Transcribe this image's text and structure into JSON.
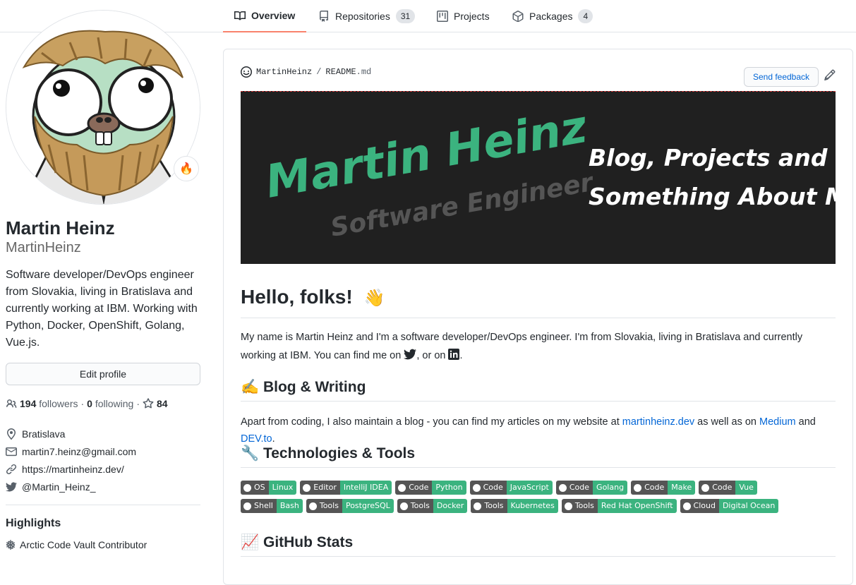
{
  "tabs": [
    {
      "label": "Overview",
      "icon": "book-icon"
    },
    {
      "label": "Repositories",
      "icon": "repo-icon",
      "count": "31"
    },
    {
      "label": "Projects",
      "icon": "project-icon"
    },
    {
      "label": "Packages",
      "icon": "package-icon",
      "count": "4"
    }
  ],
  "profile": {
    "status_emoji": "🔥",
    "fullname": "Martin Heinz",
    "username": "MartinHeinz",
    "bio": "Software developer/DevOps engineer from Slovakia, living in Bratislava and currently working at IBM. Working with Python, Docker, OpenShift, Golang, Vue.js.",
    "edit_label": "Edit profile",
    "followers_count": "194",
    "followers_label": "followers",
    "dot": "·",
    "following_count": "0",
    "following_label": "following",
    "stars_count": "84",
    "location": "Bratislava",
    "email": "martin7.heinz@gmail.com",
    "website": "https://martinheinz.dev/",
    "twitter": "@Martin_Heinz_",
    "highlights_title": "Highlights",
    "highlight": "Arctic Code Vault Contributor"
  },
  "readme": {
    "owner": "MartinHeinz",
    "slash": "/",
    "file": "README",
    "ext": ".md",
    "feedback_label": "Send feedback",
    "banner": {
      "name": "Martin Heinz",
      "role": "Software Engineer",
      "tagline1": "Blog, Projects and",
      "tagline2": "Something About Me"
    },
    "hello": "Hello, folks!",
    "hello_emoji": "👋",
    "intro_a": "My name is Martin Heinz and I'm a software developer/DevOps engineer. I'm from Slovakia, living in Bratislava and currently working at IBM. You can find me on",
    "intro_b": ", or on",
    "intro_c": ".",
    "blog_heading": "✍️ Blog & Writing",
    "blog_a": "Apart from coding, I also maintain a blog - you can find my articles on my website at",
    "blog_link1": "martinheinz.dev",
    "blog_b": "as well as on",
    "blog_link2": "Medium",
    "blog_c": "and",
    "blog_link3": "DEV.to",
    "blog_d": ".",
    "tech_heading": "🔧 Technologies & Tools",
    "badges_row1": [
      {
        "label": "OS",
        "value": "Linux"
      },
      {
        "label": "Editor",
        "value": "IntelliJ IDEA"
      },
      {
        "label": "Code",
        "value": "Python"
      },
      {
        "label": "Code",
        "value": "JavaScript"
      },
      {
        "label": "Code",
        "value": "Golang"
      },
      {
        "label": "Code",
        "value": "Make"
      },
      {
        "label": "Code",
        "value": "Vue"
      }
    ],
    "badges_row2": [
      {
        "label": "Shell",
        "value": "Bash"
      },
      {
        "label": "Tools",
        "value": "PostgreSQL"
      },
      {
        "label": "Tools",
        "value": "Docker"
      },
      {
        "label": "Tools",
        "value": "Kubernetes"
      },
      {
        "label": "Tools",
        "value": "Red Hat OpenShift"
      },
      {
        "label": "Cloud",
        "value": "Digital Ocean"
      }
    ],
    "stats_heading": "📈 GitHub Stats"
  },
  "colors": {
    "accent": "#f9826c",
    "link": "#0366d6",
    "badge_green": "#3bb37f",
    "banner_green": "#3bb37f",
    "banner_bg": "#202020"
  }
}
